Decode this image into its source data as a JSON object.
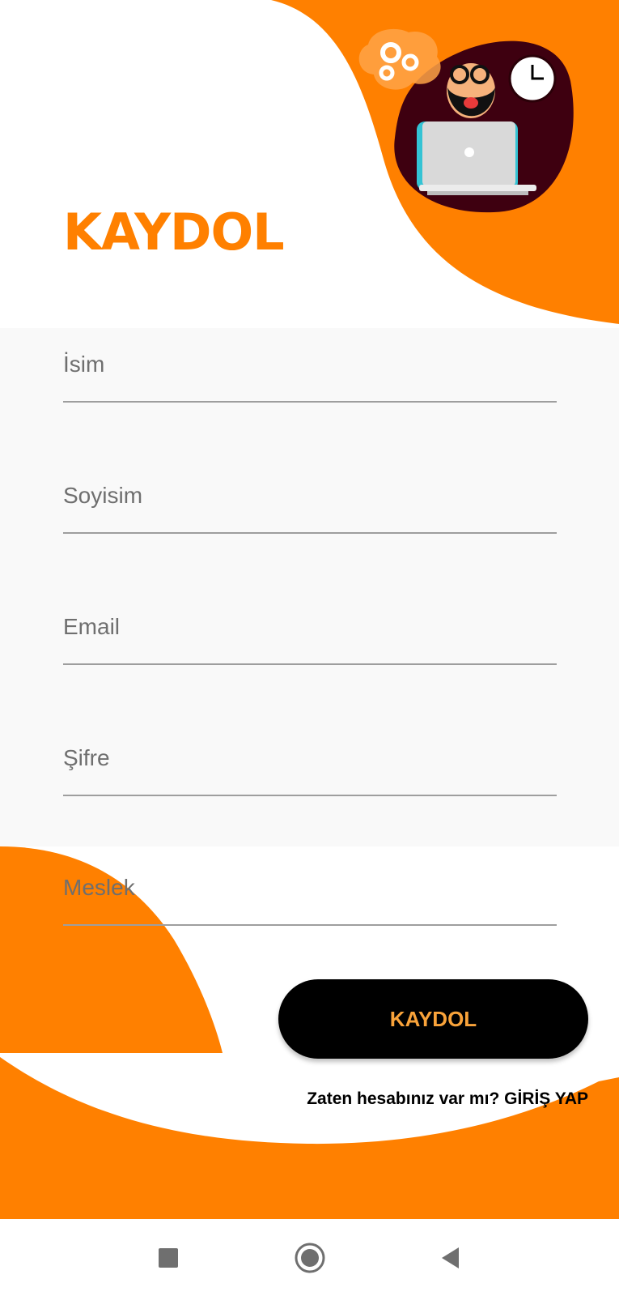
{
  "title": "KAYDOL",
  "form": {
    "fields": [
      {
        "placeholder": "İsim",
        "value": ""
      },
      {
        "placeholder": "Soyisim",
        "value": ""
      },
      {
        "placeholder": "Email",
        "value": ""
      },
      {
        "placeholder": "Şifre",
        "value": ""
      },
      {
        "placeholder": "Meslek",
        "value": ""
      }
    ]
  },
  "button": {
    "label": "KAYDOL"
  },
  "signin": {
    "prompt": "Zaten hesabınız var mı? ",
    "link": "GİRİŞ YAP"
  },
  "colors": {
    "accent": "#FF8000",
    "button_bg": "#000000",
    "button_text": "#F9A33A"
  },
  "navbar": {
    "icons": [
      "square-icon",
      "circle-home-icon",
      "back-triangle-icon"
    ]
  }
}
